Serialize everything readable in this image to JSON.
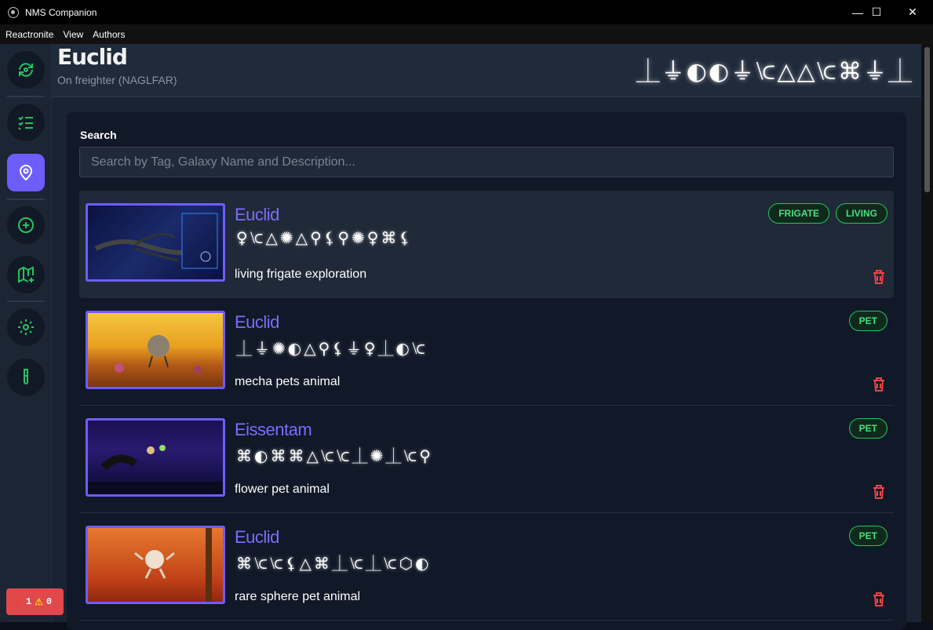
{
  "window": {
    "title": "NMS Companion",
    "minimize": "—",
    "maximize": "☐",
    "close": "✕"
  },
  "menu": [
    "Reactronite",
    "View",
    "Authors"
  ],
  "sidebar": {
    "buttons": [
      {
        "icon": "refresh-location-icon",
        "active": false
      },
      {
        "icon": "checklist-icon",
        "active": false
      },
      {
        "icon": "map-pin-icon",
        "active": true
      },
      {
        "icon": "add-circle-icon",
        "active": false
      },
      {
        "icon": "map-add-icon",
        "active": false
      },
      {
        "icon": "settings-gear-icon",
        "active": false
      },
      {
        "icon": "test-tube-icon",
        "active": false
      }
    ]
  },
  "header": {
    "galaxy": "Euclid",
    "subtitle": "On freighter (NAGLFAR)",
    "glyphs": "⏊⏚◐◐⏚⟈△△⟈⌘⏚⏊"
  },
  "search": {
    "label": "Search",
    "placeholder": "Search by Tag, Galaxy Name and Description..."
  },
  "entries": [
    {
      "galaxy": "Euclid",
      "glyphs": "♀⟈△✺△⚲⚸⚲✺♀⌘⚸",
      "description": "living frigate exploration",
      "tags": [
        "FRIGATE",
        "LIVING"
      ],
      "image": "frigate-screenshot"
    },
    {
      "galaxy": "Euclid",
      "glyphs": "⏊⏚✺◐△⚲⚸⏚♀⏊◐⟈",
      "description": "mecha pets animal",
      "tags": [
        "PET"
      ],
      "image": "mecha-pet-screenshot"
    },
    {
      "galaxy": "Eissentam",
      "glyphs": "⌘◐⌘⌘△⟈⟈⏊✺⏊⟈⚲",
      "description": "flower pet animal",
      "tags": [
        "PET"
      ],
      "image": "flower-pet-screenshot"
    },
    {
      "galaxy": "Euclid",
      "glyphs": "⌘⟈⟈⚸△⌘⏊⟈⏊⟈⬡◐",
      "description": "rare sphere pet animal",
      "tags": [
        "PET"
      ],
      "image": "sphere-pet-screenshot"
    }
  ],
  "status": {
    "errors": "1",
    "warnings": "0"
  },
  "colors": {
    "accent": "#6d5dfc",
    "tag_green": "#4ade80",
    "delete_red": "#ef4444"
  }
}
